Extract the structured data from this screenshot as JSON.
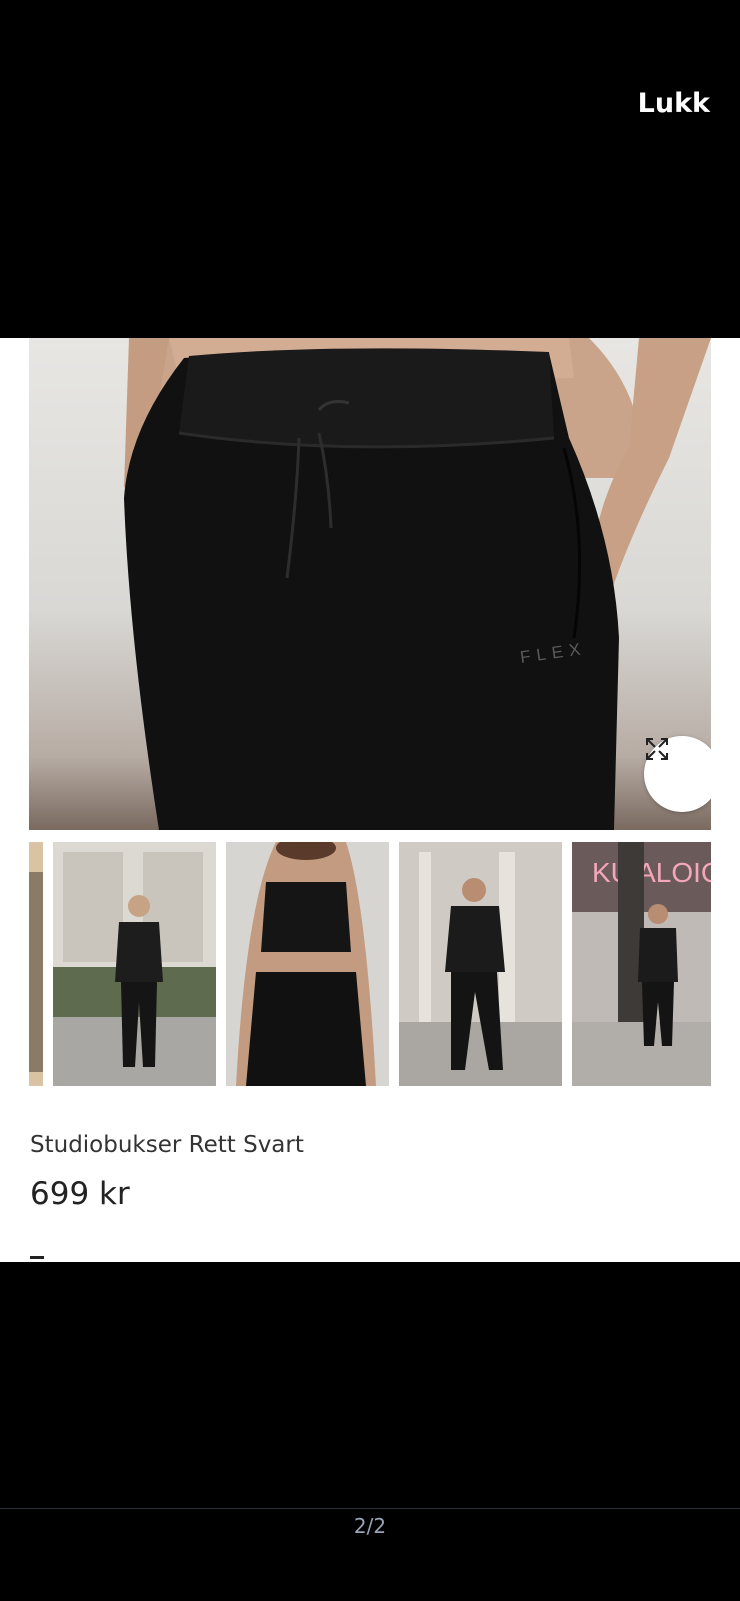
{
  "header": {
    "close_label": "Lukk"
  },
  "gallery": {
    "main_image": "black-sweatpants-closeup",
    "logo_text": "FLEX",
    "expand_icon": "expand-icon",
    "thumbnails": [
      {
        "name": "partial-thumbnail"
      },
      {
        "name": "model-black-tshirt-pants-street"
      },
      {
        "name": "model-sports-bra-pants"
      },
      {
        "name": "model-hoodie-pants-walking"
      },
      {
        "name": "model-tshirt-pants-neon-sign",
        "sign_text": "KU ALOIO"
      }
    ]
  },
  "product": {
    "name": "Studiobukser Rett Svart",
    "price": "699 kr"
  },
  "footer": {
    "page_counter": "2/2"
  }
}
